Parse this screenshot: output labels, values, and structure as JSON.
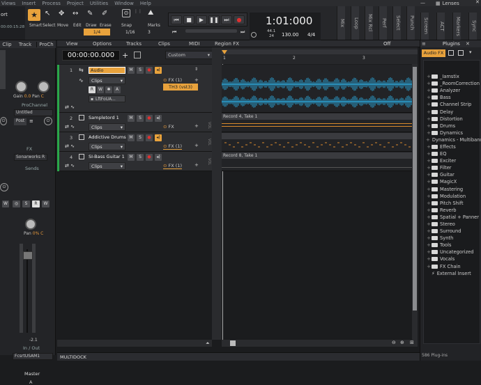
{
  "menu": [
    "Views",
    "Insert",
    "Process",
    "Project",
    "Utilities",
    "Window",
    "Help"
  ],
  "lenses_label": "Lenses",
  "tools": {
    "smart": "Smart",
    "select": "Select",
    "move": "Move",
    "edit": "Edit",
    "draw": "Draw",
    "erase": "Erase",
    "snap_label": "Snap",
    "snap_value": "1/4",
    "marks": "Marks",
    "grid_value": "1/16",
    "grid_num": "3"
  },
  "transport": {
    "time": "1:01:000",
    "sample_rate": "44.1",
    "bit_depth": "24",
    "tempo": "130.00",
    "meter": "4/4"
  },
  "left_time": "00:00:15:28",
  "left_port": "ort",
  "vtabs": [
    "Mix",
    "Loop",
    "Mix Rcl",
    "Perf",
    "Select",
    "Punch",
    "Screen",
    "ACT",
    "Markers",
    "Sync"
  ],
  "mixer": {
    "tabs": [
      "Clip",
      "Track",
      "ProCh"
    ],
    "gain_label": "Gain",
    "gain": "0.0",
    "pan_label": "Pan",
    "pan_val": "C",
    "prochannel": "ProChannel",
    "untitled": "Untitled",
    "post": "Post",
    "fx": "FX",
    "sonar": "Sonarworks R",
    "sends": "Sends",
    "pan2_label": "Pan",
    "pan2_val": "0% C",
    "fader_val": "-2.1",
    "io": "In / Out",
    "output": "FcsrtUSAM1",
    "master": "Master",
    "a": "A"
  },
  "track_menu": [
    "View",
    "Options",
    "Tracks",
    "Clips",
    "MIDI",
    "Region FX"
  ],
  "track_time": "00:00:00.000",
  "custom": "Custom",
  "off": "Off",
  "ruler": [
    "1",
    "2",
    "3"
  ],
  "tracks": [
    {
      "num": "1",
      "name": "Audio",
      "clips": "Clips",
      "fx": "FX (1)",
      "plugin": "TH3 (vst3)",
      "input": "LftFoUA...",
      "r": "R",
      "w": "W",
      "a": "A"
    },
    {
      "num": "2",
      "name": "Sampletord 1",
      "clips": "Clips",
      "fx": "FX"
    },
    {
      "num": "3",
      "name": "Addictive Drums",
      "clips": "Clips",
      "fx": "FX (1)"
    },
    {
      "num": "4",
      "name": "SI-Bass Guitar 1",
      "clips": "Clips",
      "fx": "FX (1)"
    }
  ],
  "mute": "M",
  "solo": "S",
  "clip_labels": {
    "t2": "Record 4, Take 1",
    "t4": "Record 8, Take 1"
  },
  "vol_label": "VOL",
  "plugins": {
    "tab1": "Plugins",
    "tab2": "Audio FX",
    "count": "586 Plug-ins",
    "items": [
      "_Iamstix",
      "_RoomCorrection",
      "Analyzer",
      "Bass",
      "Channel Strip",
      "Delay",
      "Distortion",
      "Drums",
      "Dynamics",
      "Dynamics - Multiband",
      "Effects",
      "EQ",
      "Exciter",
      "Filter",
      "Guitar",
      "MagicX",
      "Mastering",
      "Modulation",
      "Pitch Shift",
      "Reverb",
      "Spatial + Panner",
      "Stereo",
      "Surround",
      "Synth",
      "Tools",
      "Uncategorized",
      "Vocals",
      "FX Chain",
      "External Insert"
    ]
  },
  "multidock": "MULTIDOCK",
  "colors": {
    "accent": "#e8a23c",
    "track_green": "#2aa84a",
    "wave": "#2b9bc9",
    "clip_orange": "#d9892c"
  }
}
